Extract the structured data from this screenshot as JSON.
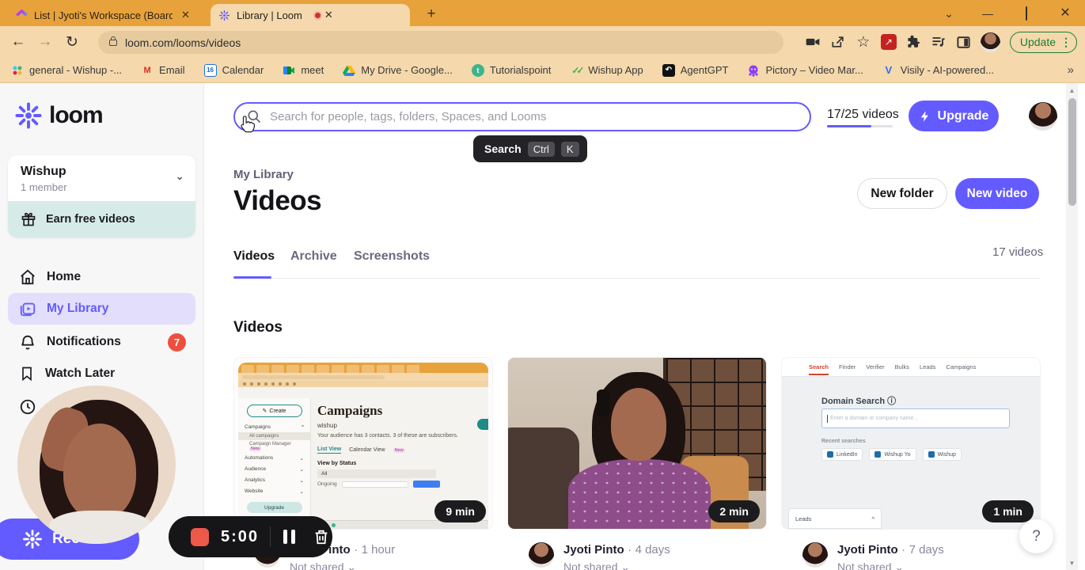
{
  "browser": {
    "tabs": [
      {
        "title": "List | Jyoti's Workspace (Board)"
      },
      {
        "title": "Library | Loom"
      }
    ],
    "url": "loom.com/looms/videos",
    "update_label": "Update",
    "calendar_day": "16",
    "bookmarks": [
      {
        "label": "general - Wishup -...",
        "icon": "slack-icon"
      },
      {
        "label": "Email",
        "icon": "gmail-icon"
      },
      {
        "label": "Calendar",
        "icon": "gcal-icon"
      },
      {
        "label": "meet",
        "icon": "meet-icon"
      },
      {
        "label": "My Drive - Google...",
        "icon": "drive-icon"
      },
      {
        "label": "Tutorialspoint",
        "icon": "tutorialspoint-icon"
      },
      {
        "label": "Wishup App",
        "icon": "wishup-icon"
      },
      {
        "label": "AgentGPT",
        "icon": "agentgpt-icon"
      },
      {
        "label": "Pictory – Video Mar...",
        "icon": "pictory-icon"
      },
      {
        "label": "Visily - AI-powered...",
        "icon": "visily-icon"
      }
    ],
    "overflow_chevron": "»"
  },
  "sidebar": {
    "logo_text": "loom",
    "workspace": {
      "name": "Wishup",
      "members": "1 member"
    },
    "earn_label": "Earn free videos",
    "items": [
      {
        "label": "Home"
      },
      {
        "label": "My Library"
      },
      {
        "label": "Notifications",
        "badge": "7"
      },
      {
        "label": "Watch Later"
      }
    ]
  },
  "recorder": {
    "rec_label": "Rec",
    "timer": "5:00"
  },
  "main": {
    "search_placeholder": "Search for people, tags, folders, Spaces, and Looms",
    "search_tooltip": {
      "label": "Search",
      "keys": [
        "Ctrl",
        "K"
      ]
    },
    "quota_label": "17/25 videos",
    "upgrade_label": "Upgrade",
    "breadcrumb": "My Library",
    "title": "Videos",
    "new_folder_label": "New folder",
    "new_video_label": "New video",
    "tabs": [
      {
        "label": "Videos"
      },
      {
        "label": "Archive"
      },
      {
        "label": "Screenshots"
      }
    ],
    "count_label": "17 videos",
    "section_title": "Videos",
    "cards": [
      {
        "duration": "9 min",
        "owner": "Jyoti Pinto",
        "sep": "·",
        "age": "1 hour",
        "shared": "Not shared ⌄"
      },
      {
        "duration": "2 min",
        "owner": "Jyoti Pinto",
        "sep": "·",
        "age": "4 days",
        "shared": "Not shared ⌄"
      },
      {
        "duration": "1 min",
        "owner": "Jyoti Pinto",
        "sep": "·",
        "age": "7 days",
        "shared": "Not shared ⌄"
      }
    ],
    "help_label": "?"
  },
  "thumb_mailchimp": {
    "create": "Create",
    "nav_campaigns": "Campaigns",
    "nav_all_campaigns": "All campaigns",
    "nav_campaign_manager": "Campaign Manager",
    "new_badge": "New",
    "nav_automations": "Automations",
    "nav_audience": "Audience",
    "nav_analytics": "Analytics",
    "nav_website": "Website",
    "upgrade": "Upgrade",
    "heading": "Campaigns",
    "subheading": "wishup",
    "audience_line": "Your audience has 3 contacts. 3 of these are subscribers.",
    "list_view": "List View",
    "calendar_view": "Calendar View",
    "view_by_status": "View by Status",
    "status_all": "All",
    "status_ongoing": "Ongoing"
  },
  "thumb_hunter": {
    "nav": [
      "Search",
      "Finder",
      "Verifier",
      "Bulks",
      "Leads",
      "Campaigns"
    ],
    "heading": "Domain Search ⓘ",
    "placeholder": "Enter a domain or company name...",
    "recent_label": "Recent searches",
    "chips": [
      "LinkedIn",
      "Wishup Yo",
      "Wishup"
    ],
    "leads_label": "Leads"
  },
  "colors": {
    "loom_purple": "#635bff",
    "tab_orange": "#e8a23c",
    "chrome_tan": "#f5d8ab",
    "badge_red": "#ee4f3c",
    "mint": "#d6ebe7",
    "update_green": "#1a7f37"
  }
}
